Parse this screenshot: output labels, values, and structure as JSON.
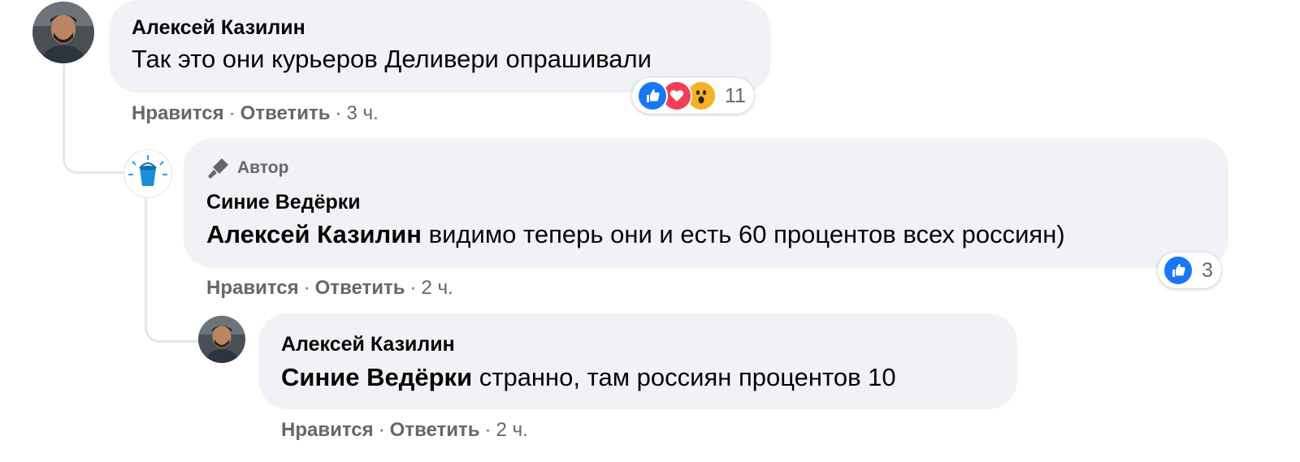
{
  "comments": [
    {
      "author": "Алексей Казилин",
      "text": "Так это они курьеров Деливери опрашивали",
      "actions": {
        "like": "Нравится",
        "reply": "Ответить",
        "time": "3 ч."
      },
      "reactions": {
        "icons": [
          "like-icon",
          "love-icon",
          "wow-icon"
        ],
        "count": "11"
      }
    },
    {
      "badge": "Автор",
      "author": "Синие Ведёрки",
      "mention": "Алексей Казилин",
      "text": " видимо теперь они и есть 60 процентов всех россиян)",
      "actions": {
        "like": "Нравится",
        "reply": "Ответить",
        "time": "2 ч."
      },
      "reactions": {
        "icons": [
          "like-icon"
        ],
        "count": "3"
      }
    },
    {
      "author": "Алексей Казилин",
      "mention": "Синие Ведёрки",
      "text": " странно, там россиян процентов 10",
      "actions": {
        "like": "Нравится",
        "reply": "Ответить",
        "time": "2 ч."
      }
    }
  ],
  "colors": {
    "bubble": "#f0f2f5",
    "like": "#1877f2",
    "love": "#f33e58",
    "wow": "#f7b125",
    "muted": "#65676b"
  }
}
